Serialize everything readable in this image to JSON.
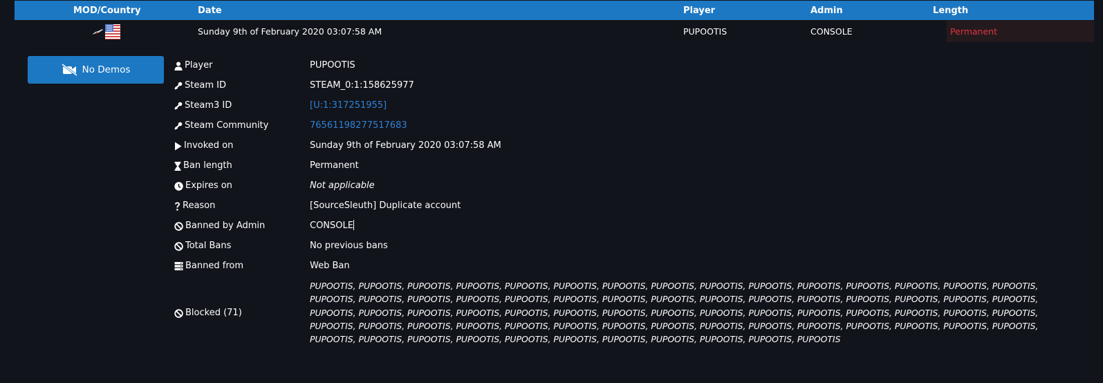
{
  "colors": {
    "background": "#12141b",
    "header": "#1d78c3",
    "link": "#2f82d6",
    "permanent_text": "#e0353d",
    "permanent_bg": "#241a1e"
  },
  "header": {
    "mod_country": "MOD/Country",
    "date": "Date",
    "player": "Player",
    "admin": "Admin",
    "length": "Length"
  },
  "summary": {
    "mod_icon": "game-mod-icon",
    "country_icon": "us-flag-icon",
    "date": "Sunday 9th of February 2020 03:07:58 AM",
    "player": "PUPOOTIS",
    "admin": "CONSOLE",
    "length": "Permanent"
  },
  "demo_button": {
    "icon": "video-slash-icon",
    "label": "No Demos"
  },
  "details": [
    {
      "key": "player",
      "icon": "user-icon",
      "label": "Player",
      "value": "PUPOOTIS"
    },
    {
      "key": "steam_id",
      "icon": "steam-icon",
      "label": "Steam ID",
      "value": "STEAM_0:1:158625977"
    },
    {
      "key": "steam3_id",
      "icon": "steam-icon",
      "label": "Steam3 ID",
      "value": "[U:1:317251955]"
    },
    {
      "key": "steam_community",
      "icon": "steam-icon",
      "label": "Steam Community",
      "value": "76561198277517683"
    },
    {
      "key": "invoked_on",
      "icon": "play-icon",
      "label": "Invoked on",
      "value": "Sunday 9th of February 2020 03:07:58 AM"
    },
    {
      "key": "ban_length",
      "icon": "hourglass-icon",
      "label": "Ban length",
      "value": "Permanent"
    },
    {
      "key": "expires_on",
      "icon": "clock-icon",
      "label": "Expires on",
      "value": "Not applicable"
    },
    {
      "key": "reason",
      "icon": "question-icon",
      "label": "Reason",
      "value": "[SourceSleuth] Duplicate account"
    },
    {
      "key": "banned_by",
      "icon": "ban-icon",
      "label": "Banned by Admin",
      "value": "CONSOLE"
    },
    {
      "key": "total_bans",
      "icon": "ban-icon",
      "label": "Total Bans",
      "value": "No previous bans"
    },
    {
      "key": "banned_from",
      "icon": "server-icon",
      "label": "Banned from",
      "value": "Web Ban"
    },
    {
      "key": "blocked",
      "icon": "ban-icon",
      "label": "Blocked (71)",
      "value": "PUPOOTIS, PUPOOTIS, PUPOOTIS, PUPOOTIS, PUPOOTIS, PUPOOTIS, PUPOOTIS, PUPOOTIS, PUPOOTIS, PUPOOTIS, PUPOOTIS, PUPOOTIS, PUPOOTIS, PUPOOTIS, PUPOOTIS, PUPOOTIS, PUPOOTIS, PUPOOTIS, PUPOOTIS, PUPOOTIS, PUPOOTIS, PUPOOTIS, PUPOOTIS, PUPOOTIS, PUPOOTIS, PUPOOTIS, PUPOOTIS, PUPOOTIS, PUPOOTIS, PUPOOTIS, PUPOOTIS, PUPOOTIS, PUPOOTIS, PUPOOTIS, PUPOOTIS, PUPOOTIS, PUPOOTIS, PUPOOTIS, PUPOOTIS, PUPOOTIS, PUPOOTIS, PUPOOTIS, PUPOOTIS, PUPOOTIS, PUPOOTIS, PUPOOTIS, PUPOOTIS, PUPOOTIS, PUPOOTIS, PUPOOTIS, PUPOOTIS, PUPOOTIS, PUPOOTIS, PUPOOTIS, PUPOOTIS, PUPOOTIS, PUPOOTIS, PUPOOTIS, PUPOOTIS, PUPOOTIS, PUPOOTIS, PUPOOTIS, PUPOOTIS, PUPOOTIS, PUPOOTIS, PUPOOTIS, PUPOOTIS, PUPOOTIS, PUPOOTIS, PUPOOTIS, PUPOOTIS"
    }
  ]
}
